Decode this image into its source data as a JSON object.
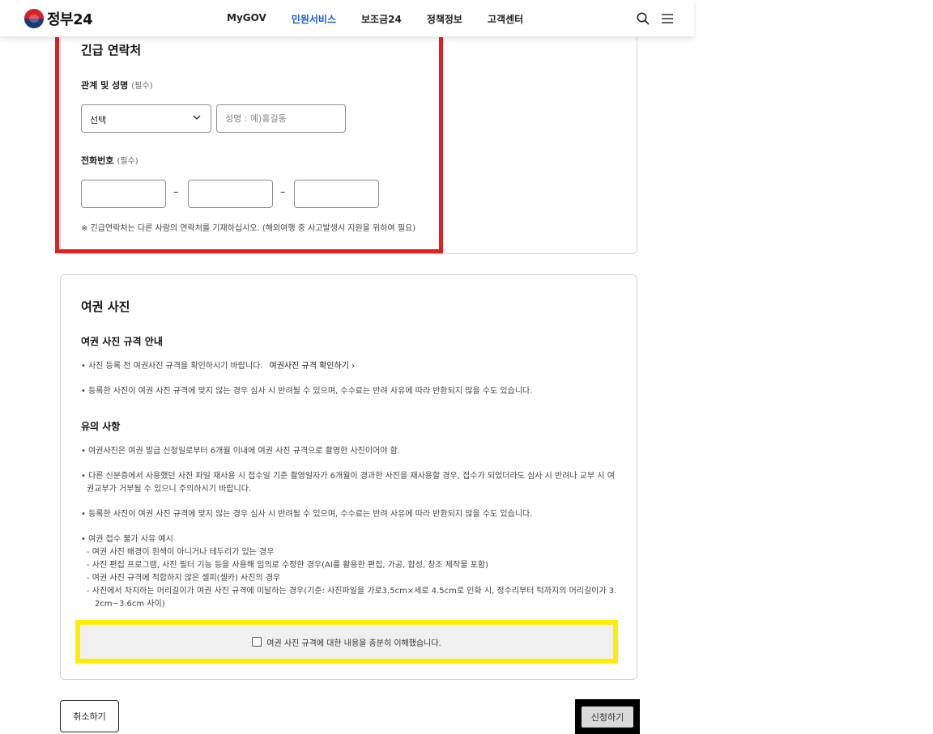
{
  "header": {
    "logo_text": "정부24",
    "nav": [
      "MyGOV",
      "민원서비스",
      "보조금24",
      "정책정보",
      "고객센터"
    ],
    "active_nav": "민원서비스",
    "search_icon": "search-icon",
    "menu_icon": "hamburger-menu-icon"
  },
  "emergency": {
    "title": "긴급 연락처",
    "relation_label": "관계 및 성명",
    "required": "(필수)",
    "relation_select": "선택",
    "name_placeholder": "성명 : 예)홍길동",
    "phone_label": "전화번호",
    "dash": "–",
    "note": "※ 긴급연락처는 다른 사람의 연락처를 기재하십시오. (해외여행 중 사고발생시 지원을 위하여 필요)"
  },
  "photo": {
    "title": "여권 사진",
    "spec_title": "여권 사진 규격 안내",
    "spec_items": [
      "사진 등록 전 여권사진 규격을 확인하시기 바랍니다.",
      "등록한 사진이 여권 사진 규격에 맞지 않는 경우 심사 시 반려될 수 있으며, 수수료는 반려 사유에 따라 반환되지 않을 수도 있습니다."
    ],
    "spec_link": "여권사진 규격 확인하기",
    "notice_title": "유의 사항",
    "notice_items": [
      "여권사진은 여권 발급 신청일로부터 6개월 이내에 여권 사진 규격으로 촬영한 사진이어야 함.",
      "다른 신분증에서 사용했던 사진 파일 재사용 시 접수일 기준 촬영일자가 6개월이 경과한 사진을 재사용할 경우, 접수가 되었더라도 심사 시 반려나 교부 시 여",
      "권교부가 거부될 수 있으니 주의하시기 바랍니다.",
      "등록한 사진이 여권 사진 규격에 맞지 않는 경우 심사 시 반려될 수 있으며, 수수료는 반려 사유에 따라 반환되지 않을 수도 있습니다.",
      "여권 접수 불가 사유 예시"
    ],
    "reject_examples": [
      "- 여권 사진 배경이 흰색이 아니거나 테두리가 있는 경우",
      "- 사진 편집 프로그램, 사진 필터 기능 등을 사용해 임의로 수정한 경우(AI를 활용한 편집, 가공, 합성, 창조 제작물 포함)",
      "- 여권 사진 규격에 적합하지 않은 셀피(셀카) 사진의 경우",
      "- 사진에서 차지하는 머리길이가 여권 사진 규격에 미달하는 경우(기준: 사진파일을 가로3.5cm×세로 4.5cm로 인화 시, 정수리부터 턱까지의 머리길이가 3.",
      "2cm~3.6cm 사이)"
    ],
    "agree_label": "여권 사진 규격에 대한 내용을 충분히 이해했습니다."
  },
  "actions": {
    "cancel": "취소하기",
    "submit": "신청하기"
  },
  "colors": {
    "active_nav": "#1f5bd8",
    "highlight_red": "#e02020",
    "highlight_yellow": "#ffee00",
    "submit_frame": "#000000"
  }
}
